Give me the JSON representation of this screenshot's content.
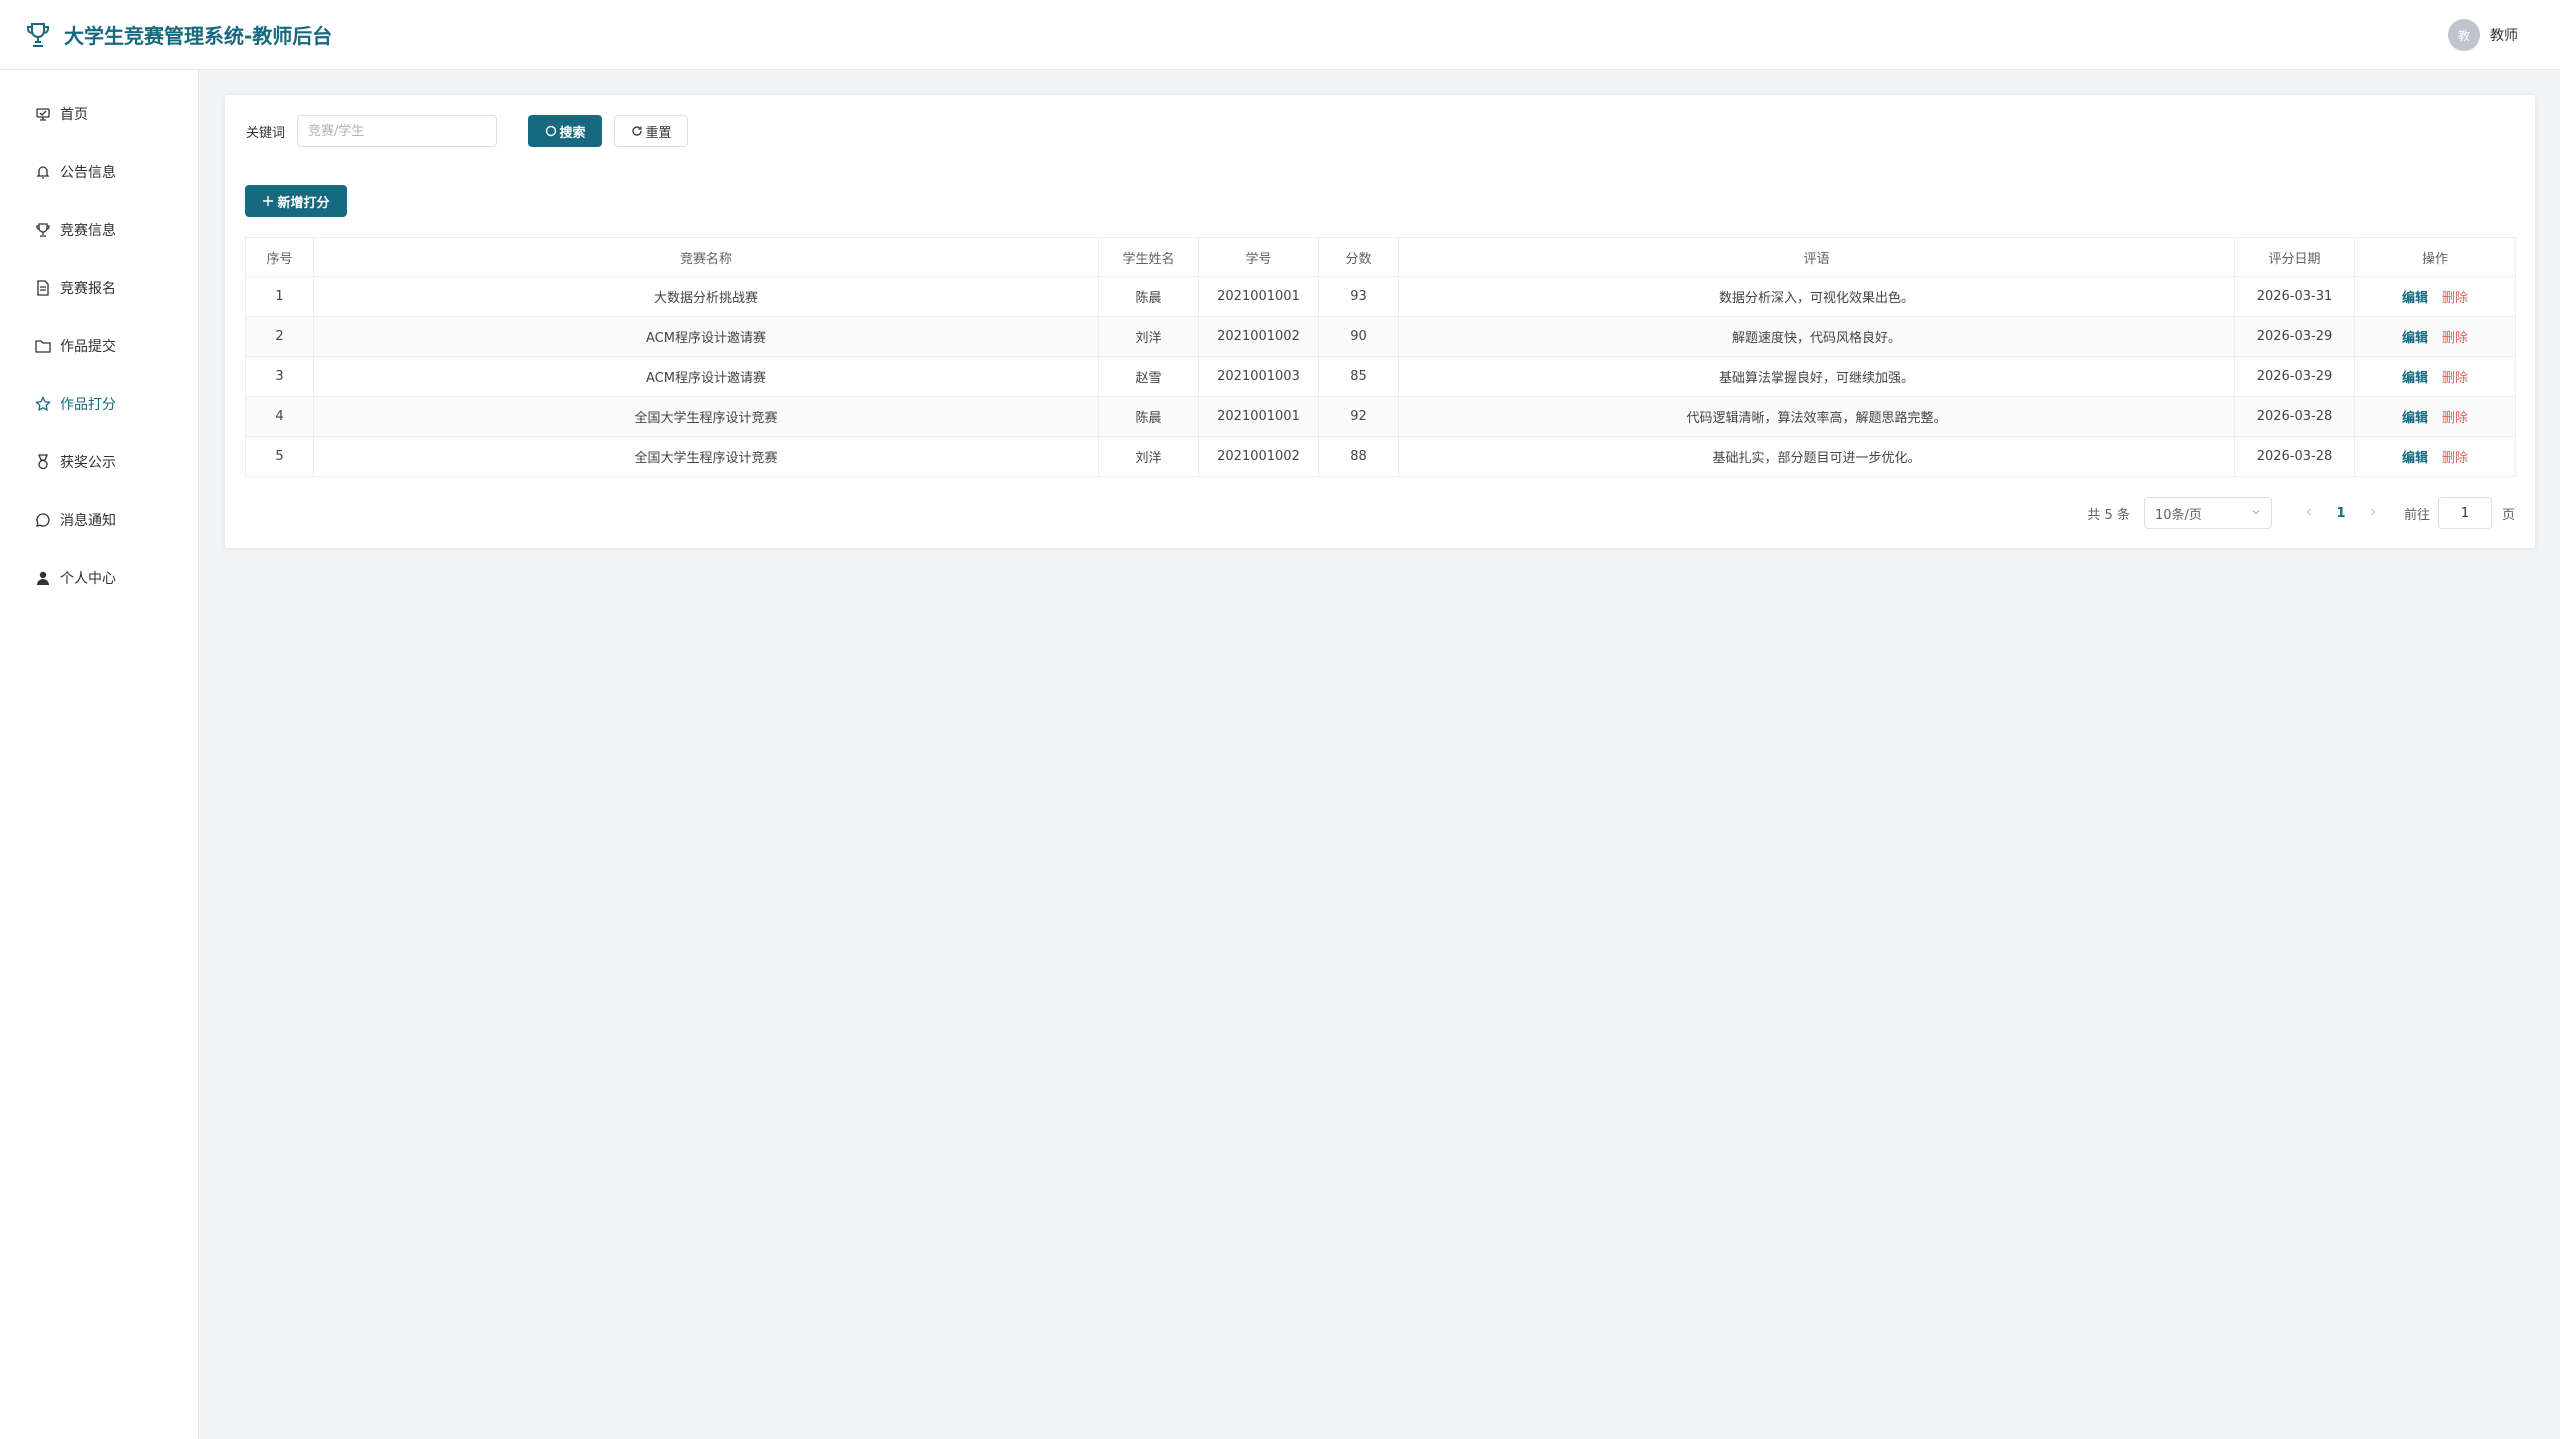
{
  "header": {
    "title": "大学生竞赛管理系统-教师后台",
    "avatar_text": "教",
    "user_name": "教师"
  },
  "sidebar": {
    "items": [
      {
        "label": "首页",
        "icon": "home-icon"
      },
      {
        "label": "公告信息",
        "icon": "bell-icon"
      },
      {
        "label": "竞赛信息",
        "icon": "trophy-icon"
      },
      {
        "label": "竞赛报名",
        "icon": "document-icon"
      },
      {
        "label": "作品提交",
        "icon": "folder-icon"
      },
      {
        "label": "作品打分",
        "icon": "star-icon",
        "active": true
      },
      {
        "label": "获奖公示",
        "icon": "medal-icon"
      },
      {
        "label": "消息通知",
        "icon": "chat-icon"
      },
      {
        "label": "个人中心",
        "icon": "user-icon"
      }
    ]
  },
  "search": {
    "label": "关键词",
    "placeholder": "竞赛/学生",
    "search_label": "搜索",
    "reset_label": "重置"
  },
  "add_button_label": "新增打分",
  "table": {
    "columns": [
      "序号",
      "竞赛名称",
      "学生姓名",
      "学号",
      "分数",
      "评语",
      "评分日期",
      "操作"
    ],
    "rows": [
      {
        "index": "1",
        "competition": "大数据分析挑战赛",
        "student": "陈晨",
        "student_no": "2021001001",
        "score": "93",
        "comment": "数据分析深入，可视化效果出色。",
        "date": "2026-03-31"
      },
      {
        "index": "2",
        "competition": "ACM程序设计邀请赛",
        "student": "刘洋",
        "student_no": "2021001002",
        "score": "90",
        "comment": "解题速度快，代码风格良好。",
        "date": "2026-03-29"
      },
      {
        "index": "3",
        "competition": "ACM程序设计邀请赛",
        "student": "赵雪",
        "student_no": "2021001003",
        "score": "85",
        "comment": "基础算法掌握良好，可继续加强。",
        "date": "2026-03-29"
      },
      {
        "index": "4",
        "competition": "全国大学生程序设计竞赛",
        "student": "陈晨",
        "student_no": "2021001001",
        "score": "92",
        "comment": "代码逻辑清晰，算法效率高，解题思路完整。",
        "date": "2026-03-28"
      },
      {
        "index": "5",
        "competition": "全国大学生程序设计竞赛",
        "student": "刘洋",
        "student_no": "2021001002",
        "score": "88",
        "comment": "基础扎实，部分题目可进一步优化。",
        "date": "2026-03-28"
      }
    ],
    "edit_label": "编辑",
    "delete_label": "删除"
  },
  "pagination": {
    "total_text": "共 5 条",
    "page_size": "10条/页",
    "current_page": "1",
    "goto_label": "前往",
    "goto_value": "1",
    "goto_suffix": "页"
  },
  "colors": {
    "primary": "#17697f",
    "danger": "#f05a5a"
  }
}
